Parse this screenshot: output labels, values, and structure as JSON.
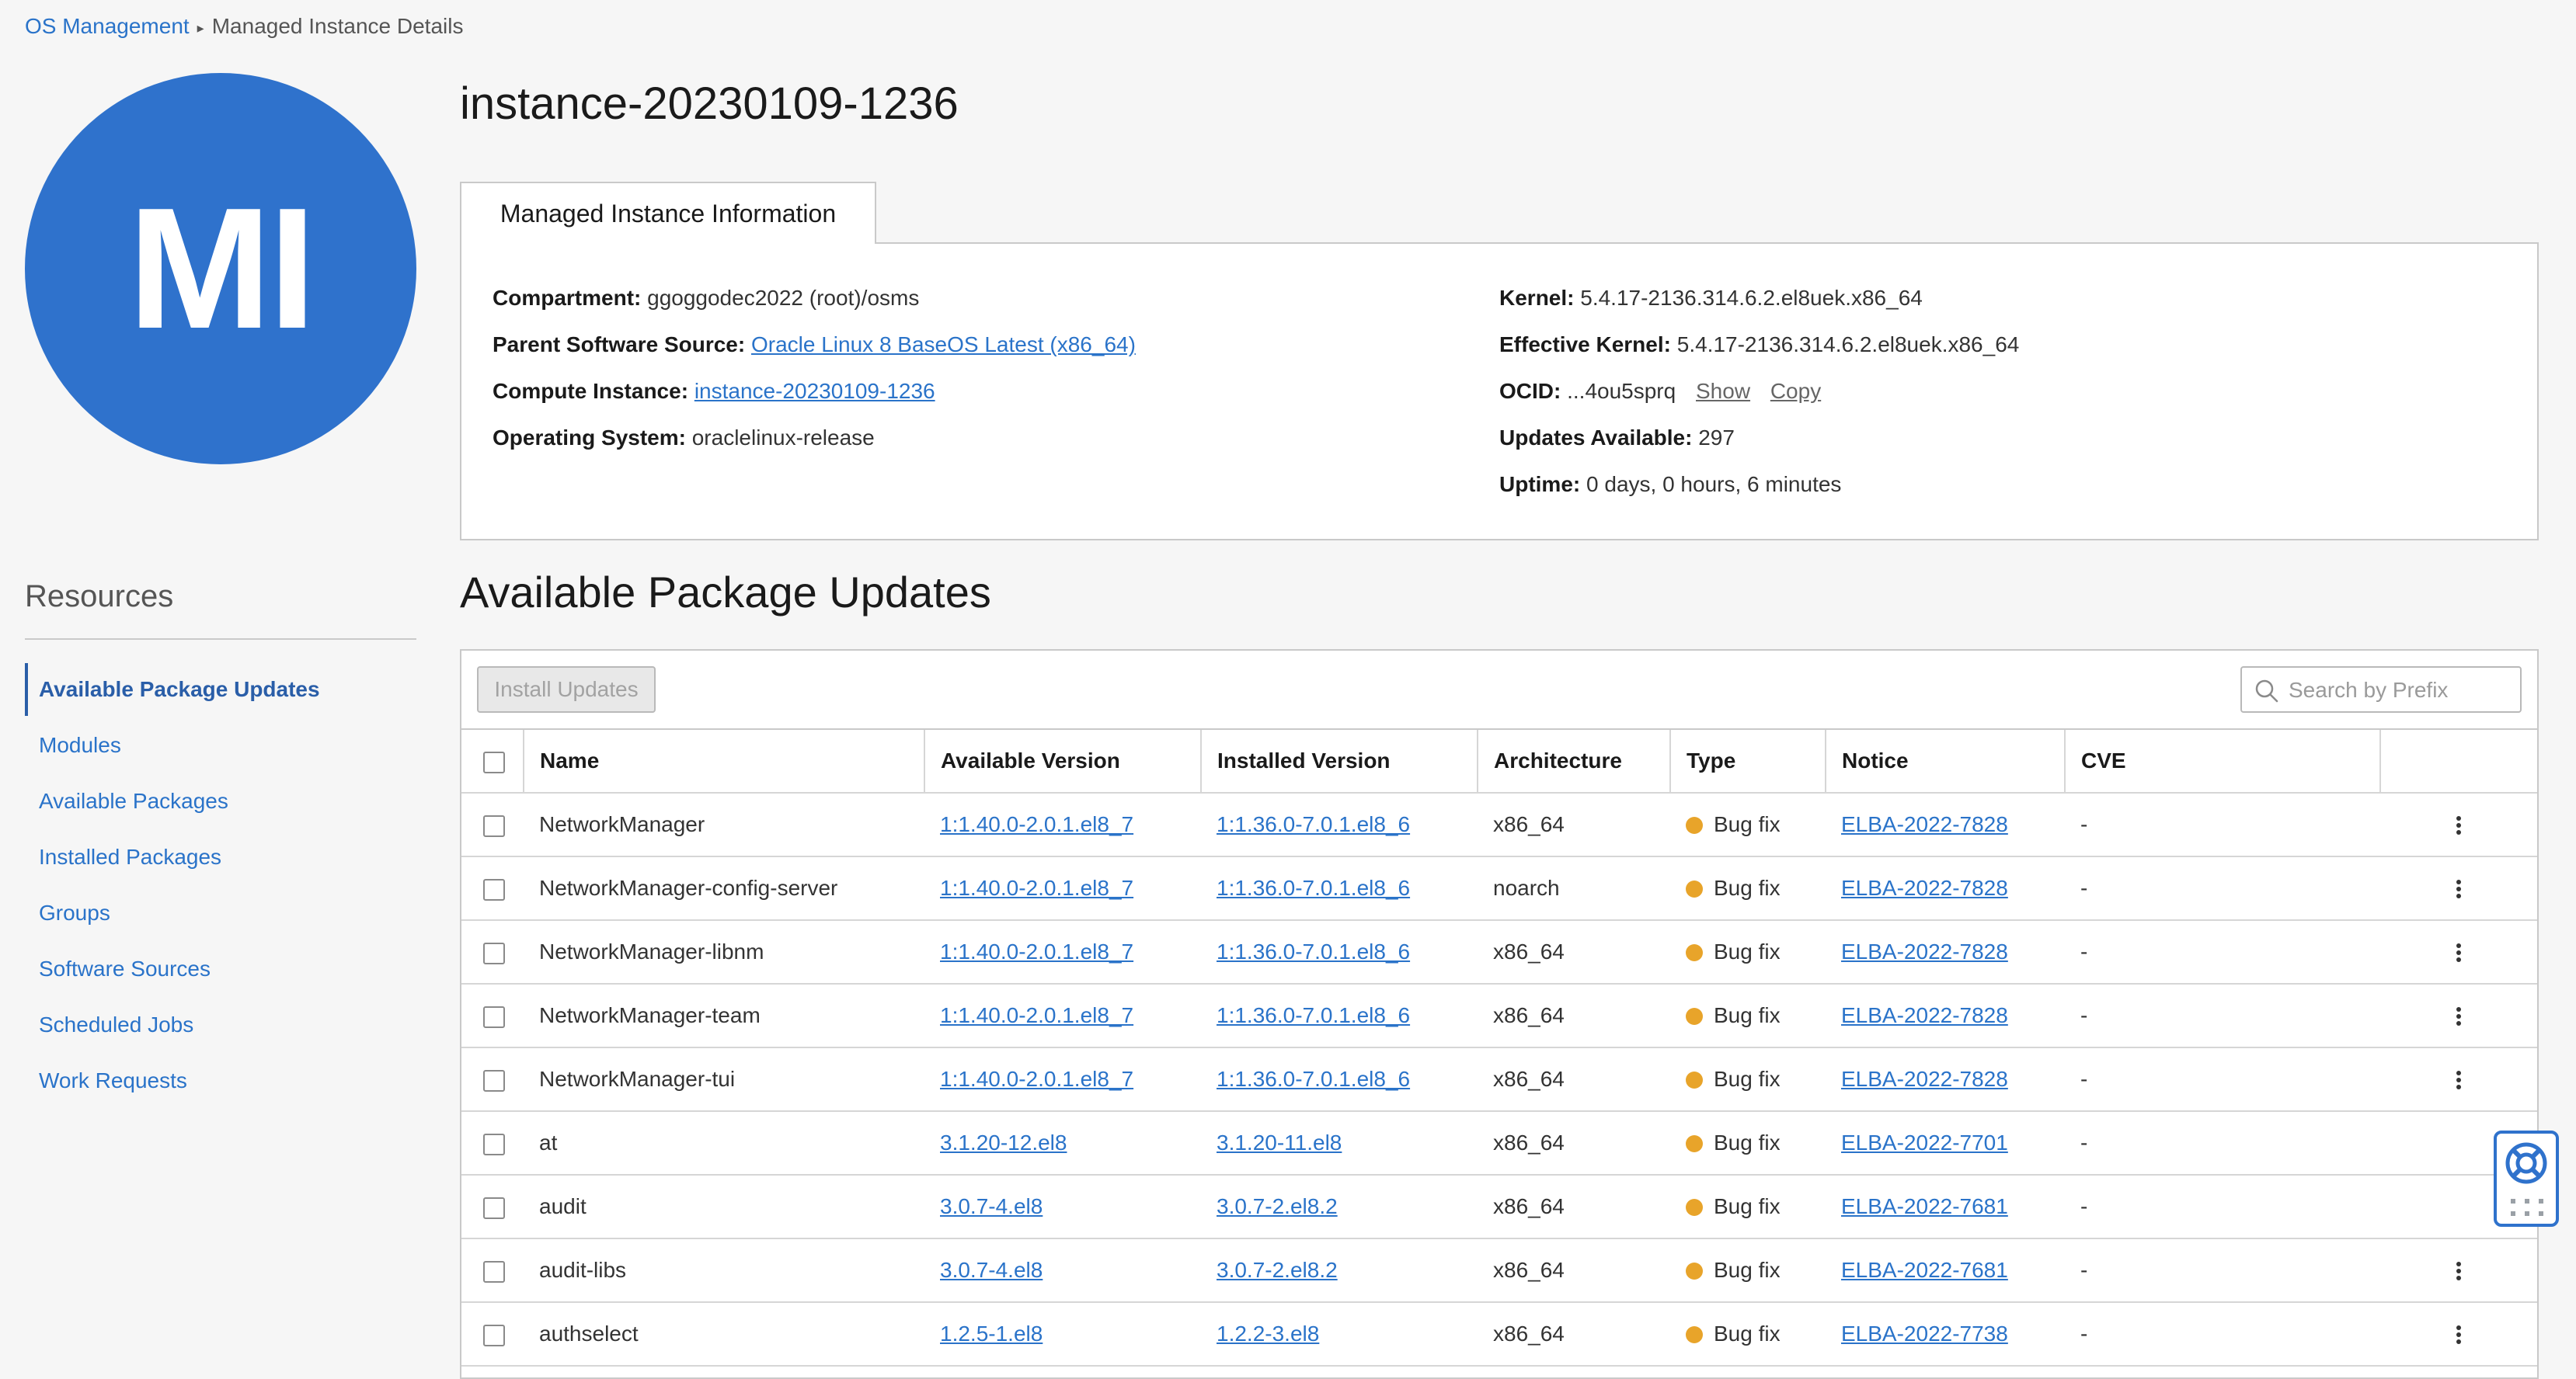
{
  "breadcrumb": {
    "root": "OS Management",
    "current": "Managed Instance Details"
  },
  "avatar": {
    "initials": "MI",
    "color": "#2f72cc"
  },
  "resources": {
    "title": "Resources",
    "items": [
      {
        "label": "Available Package Updates",
        "active": true
      },
      {
        "label": "Modules"
      },
      {
        "label": "Available Packages"
      },
      {
        "label": "Installed Packages"
      },
      {
        "label": "Groups"
      },
      {
        "label": "Software Sources"
      },
      {
        "label": "Scheduled Jobs"
      },
      {
        "label": "Work Requests"
      }
    ]
  },
  "instance": {
    "title": "instance-20230109-1236"
  },
  "info": {
    "tab_label": "Managed Instance Information",
    "compartment_label": "Compartment:",
    "compartment_value": "ggoggodec2022 (root)/osms",
    "parent_source_label": "Parent Software Source:",
    "parent_source_value": "Oracle Linux 8 BaseOS Latest (x86_64)",
    "compute_label": "Compute Instance:",
    "compute_value": "instance-20230109-1236",
    "os_label": "Operating System:",
    "os_value": "oraclelinux-release",
    "kernel_label": "Kernel:",
    "kernel_value": "5.4.17-2136.314.6.2.el8uek.x86_64",
    "effective_kernel_label": "Effective Kernel:",
    "effective_kernel_value": "5.4.17-2136.314.6.2.el8uek.x86_64",
    "ocid_label": "OCID:",
    "ocid_value": "...4ou5sprq",
    "ocid_show": "Show",
    "ocid_copy": "Copy",
    "updates_label": "Updates Available:",
    "updates_value": "297",
    "uptime_label": "Uptime:",
    "uptime_value": "0 days, 0 hours, 6 minutes"
  },
  "updates": {
    "title": "Available Package Updates",
    "install_button": "Install Updates",
    "search_placeholder": "Search by Prefix",
    "columns": {
      "name": "Name",
      "available": "Available Version",
      "installed": "Installed Version",
      "arch": "Architecture",
      "type": "Type",
      "notice": "Notice",
      "cve": "CVE"
    },
    "type_dot_color": "#e8a42a",
    "rows": [
      {
        "name": "NetworkManager",
        "available": "1:1.40.0-2.0.1.el8_7",
        "installed": "1:1.36.0-7.0.1.el8_6",
        "arch": "x86_64",
        "type": "Bug fix",
        "notice": "ELBA-2022-7828",
        "cve": "-"
      },
      {
        "name": "NetworkManager-config-server",
        "available": "1:1.40.0-2.0.1.el8_7",
        "installed": "1:1.36.0-7.0.1.el8_6",
        "arch": "noarch",
        "type": "Bug fix",
        "notice": "ELBA-2022-7828",
        "cve": "-"
      },
      {
        "name": "NetworkManager-libnm",
        "available": "1:1.40.0-2.0.1.el8_7",
        "installed": "1:1.36.0-7.0.1.el8_6",
        "arch": "x86_64",
        "type": "Bug fix",
        "notice": "ELBA-2022-7828",
        "cve": "-"
      },
      {
        "name": "NetworkManager-team",
        "available": "1:1.40.0-2.0.1.el8_7",
        "installed": "1:1.36.0-7.0.1.el8_6",
        "arch": "x86_64",
        "type": "Bug fix",
        "notice": "ELBA-2022-7828",
        "cve": "-"
      },
      {
        "name": "NetworkManager-tui",
        "available": "1:1.40.0-2.0.1.el8_7",
        "installed": "1:1.36.0-7.0.1.el8_6",
        "arch": "x86_64",
        "type": "Bug fix",
        "notice": "ELBA-2022-7828",
        "cve": "-"
      },
      {
        "name": "at",
        "available": "3.1.20-12.el8",
        "installed": "3.1.20-11.el8",
        "arch": "x86_64",
        "type": "Bug fix",
        "notice": "ELBA-2022-7701",
        "cve": "-"
      },
      {
        "name": "audit",
        "available": "3.0.7-4.el8",
        "installed": "3.0.7-2.el8.2",
        "arch": "x86_64",
        "type": "Bug fix",
        "notice": "ELBA-2022-7681",
        "cve": "-"
      },
      {
        "name": "audit-libs",
        "available": "3.0.7-4.el8",
        "installed": "3.0.7-2.el8.2",
        "arch": "x86_64",
        "type": "Bug fix",
        "notice": "ELBA-2022-7681",
        "cve": "-"
      },
      {
        "name": "authselect",
        "available": "1.2.5-1.el8",
        "installed": "1.2.2-3.el8",
        "arch": "x86_64",
        "type": "Bug fix",
        "notice": "ELBA-2022-7738",
        "cve": "-"
      }
    ]
  }
}
